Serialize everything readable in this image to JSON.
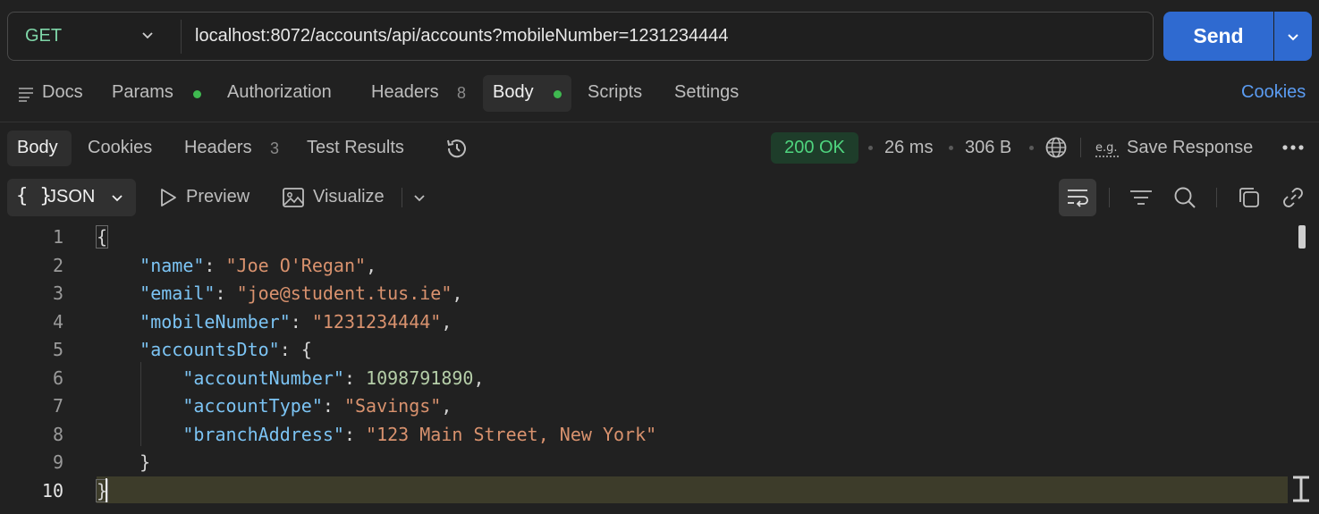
{
  "request": {
    "method": "GET",
    "url": "localhost:8072/accounts/api/accounts?mobileNumber=1231234444",
    "send_label": "Send"
  },
  "request_tabs": {
    "docs": "Docs",
    "params": "Params",
    "authorization": "Authorization",
    "headers": "Headers",
    "headers_count": "8",
    "body": "Body",
    "scripts": "Scripts",
    "settings": "Settings",
    "cookies": "Cookies"
  },
  "response_tabs": {
    "body": "Body",
    "cookies": "Cookies",
    "headers": "Headers",
    "headers_count": "3",
    "test_results": "Test Results"
  },
  "response_meta": {
    "status": "200 OK",
    "time": "26 ms",
    "size": "306 B",
    "save_response": "Save Response"
  },
  "toolbar": {
    "format": "JSON",
    "preview": "Preview",
    "visualize": "Visualize"
  },
  "editor": {
    "line_numbers": [
      "1",
      "2",
      "3",
      "4",
      "5",
      "6",
      "7",
      "8",
      "9",
      "10"
    ],
    "lines": [
      "{",
      "    \"name\": \"Joe O'Regan\",",
      "    \"email\": \"joe@student.tus.ie\",",
      "    \"mobileNumber\": \"1231234444\",",
      "    \"accountsDto\": {",
      "        \"accountNumber\": 1098791890,",
      "        \"accountType\": \"Savings\",",
      "        \"branchAddress\": \"123 Main Street, New York\"",
      "    }",
      "}"
    ],
    "highlighted_line": 10
  },
  "colors": {
    "accent": "#2f6ad0",
    "status_green": "#4fd57f",
    "json_key": "#7cc4f4",
    "json_string": "#d9926e",
    "json_number": "#b5cea8"
  },
  "icons": [
    "chevron-down-icon",
    "docs-icon",
    "history-icon",
    "globe-icon",
    "example-icon",
    "more-icon",
    "play-icon",
    "image-icon",
    "wrap-icon",
    "filter-icon",
    "search-icon",
    "copy-icon",
    "link-icon"
  ]
}
